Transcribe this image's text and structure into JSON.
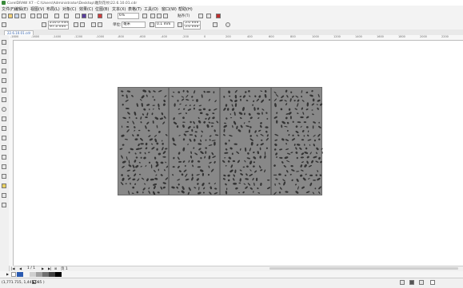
{
  "window": {
    "title": "CorelDRAW X7 - C:\\Users\\Administrator\\Desktop\\雕刻花纹\\22.6.10.01.cdr"
  },
  "menu": [
    "文件(F)",
    "编辑(E)",
    "视图(V)",
    "布局(L)",
    "对象(C)",
    "效果(C)",
    "位图(B)",
    "文本(X)",
    "表格(T)",
    "工具(O)",
    "窗口(W)",
    "帮助(H)"
  ],
  "toolbar1": {
    "zoom": "6%",
    "snap_label": "贴齐(T)"
  },
  "toolbar2": {
    "width": "210.0 mm",
    "height": "97.3 mm",
    "unit_label": "单位:",
    "unit": "毫米",
    "nudge": "0.1 mm",
    "dup_x": "5.0 mm",
    "dup_y": "5.0 mm",
    "origin_x": "1"
  },
  "doc_tab": "22.6.10.01.cdr",
  "ruler_ticks": [
    "-1800",
    "-1600",
    "-1400",
    "-1200",
    "-1000",
    "-800",
    "-600",
    "-400",
    "-200",
    "0",
    "200",
    "400",
    "600",
    "800",
    "1000",
    "1200",
    "1400",
    "1600",
    "1800",
    "2000",
    "2200"
  ],
  "page_nav": {
    "position": "1 / 1",
    "page_label": "页 1"
  },
  "status": {
    "coords": "(1,771.715, 1,447.085 )"
  },
  "panel_color": "#888888",
  "cutout_color": "#333333"
}
